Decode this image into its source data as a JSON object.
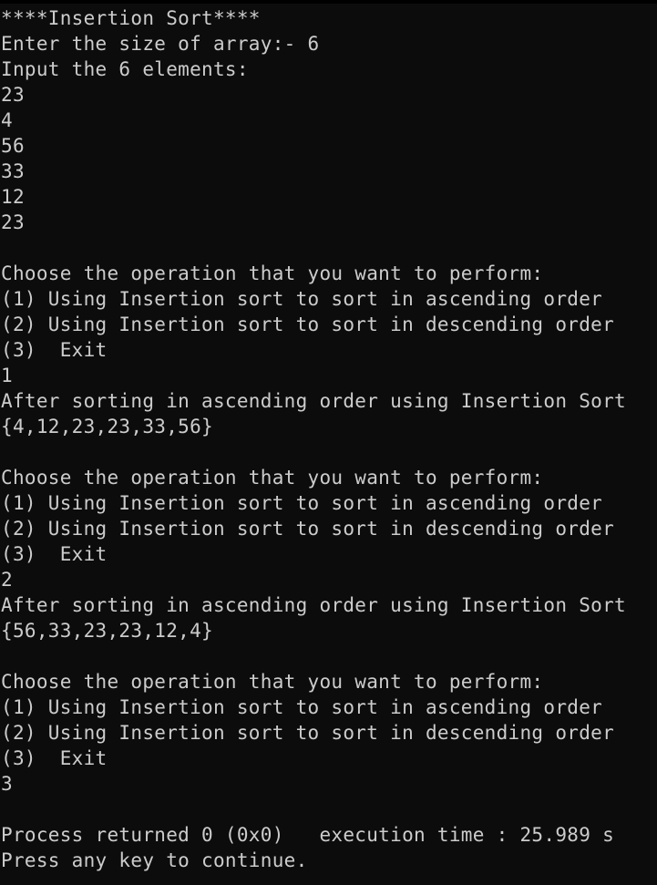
{
  "console": {
    "lines": [
      "****Insertion Sort****",
      "Enter the size of array:- 6",
      "Input the 6 elements:",
      "23",
      "4",
      "56",
      "33",
      "12",
      "23",
      "",
      "Choose the operation that you want to perform:",
      "(1) Using Insertion sort to sort in ascending order",
      "(2) Using Insertion sort to sort in descending order",
      "(3)  Exit",
      "1",
      "After sorting in ascending order using Insertion Sort",
      "{4,12,23,23,33,56}",
      "",
      "Choose the operation that you want to perform:",
      "(1) Using Insertion sort to sort in ascending order",
      "(2) Using Insertion sort to sort in descending order",
      "(3)  Exit",
      "2",
      "After sorting in ascending order using Insertion Sort",
      "{56,33,23,23,12,4}",
      "",
      "Choose the operation that you want to perform:",
      "(1) Using Insertion sort to sort in ascending order",
      "(2) Using Insertion sort to sort in descending order",
      "(3)  Exit",
      "3",
      "",
      "Process returned 0 (0x0)   execution time : 25.989 s",
      "Press any key to continue."
    ]
  },
  "colors": {
    "background": "#0c0c0c",
    "text": "#cccccc"
  }
}
